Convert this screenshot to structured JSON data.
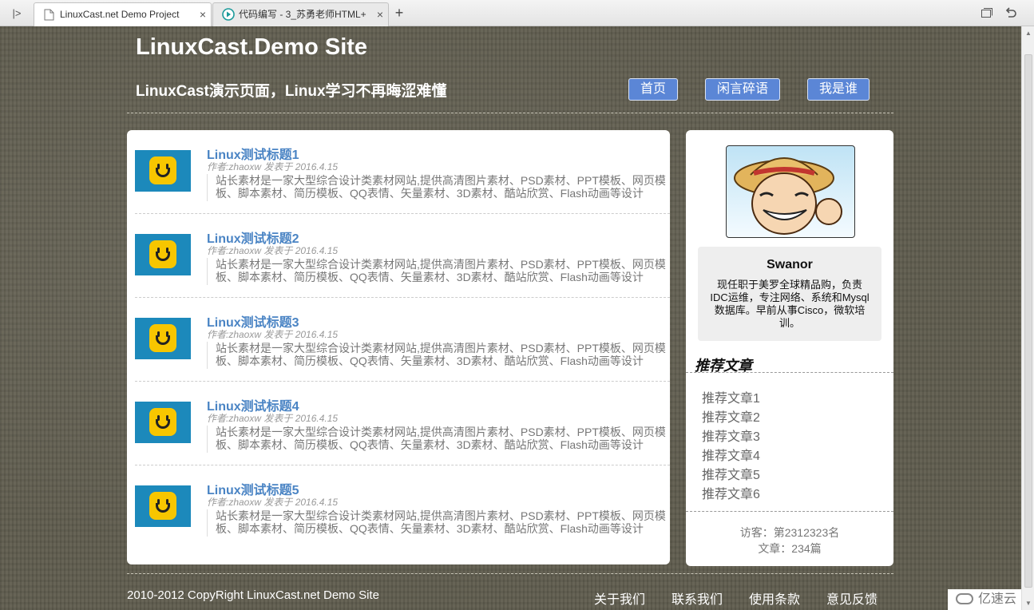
{
  "browser": {
    "tabs": [
      {
        "label": "LinuxCast.net Demo Project",
        "active": true
      },
      {
        "label": "代码编写 - 3_苏勇老师HTML+",
        "active": false
      }
    ],
    "sidebar_toggle": "|>",
    "new_tab": "+",
    "close": "×"
  },
  "site": {
    "title": "LinuxCast.Demo Site",
    "subtitle": "LinuxCast演示页面，Linux学习不再晦涩难懂",
    "nav": [
      "首页",
      "闲言碎语",
      "我是谁"
    ]
  },
  "articles": [
    {
      "title": "Linux测试标题1",
      "meta": "作者:zhaoxw 发表于 2016.4.15",
      "desc": "站长素材是一家大型综合设计类素材网站,提供高清图片素材、PSD素材、PPT模板、网页模板、脚本素材、简历模板、QQ表情、矢量素材、3D素材、酷站欣赏、Flash动画等设计"
    },
    {
      "title": "Linux测试标题2",
      "meta": "作者:zhaoxw 发表于 2016.4.15",
      "desc": "站长素材是一家大型综合设计类素材网站,提供高清图片素材、PSD素材、PPT模板、网页模板、脚本素材、简历模板、QQ表情、矢量素材、3D素材、酷站欣赏、Flash动画等设计"
    },
    {
      "title": "Linux测试标题3",
      "meta": "作者:zhaoxw 发表于 2016.4.15",
      "desc": "站长素材是一家大型综合设计类素材网站,提供高清图片素材、PSD素材、PPT模板、网页模板、脚本素材、简历模板、QQ表情、矢量素材、3D素材、酷站欣赏、Flash动画等设计"
    },
    {
      "title": "Linux测试标题4",
      "meta": "作者:zhaoxw 发表于 2016.4.15",
      "desc": "站长素材是一家大型综合设计类素材网站,提供高清图片素材、PSD素材、PPT模板、网页模板、脚本素材、简历模板、QQ表情、矢量素材、3D素材、酷站欣赏、Flash动画等设计"
    },
    {
      "title": "Linux测试标题5",
      "meta": "作者:zhaoxw 发表于 2016.4.15",
      "desc": "站长素材是一家大型综合设计类素材网站,提供高清图片素材、PSD素材、PPT模板、网页模板、脚本素材、简历模板、QQ表情、矢量素材、3D素材、酷站欣赏、Flash动画等设计"
    }
  ],
  "sidebar": {
    "name": "Swanor",
    "bio": "现任职于美罗全球精品购，负责IDC运维，专注网络、系统和Mysql数据库。早前从事Cisco，微软培训。",
    "recommend_title": "推荐文章",
    "recommend": [
      "推荐文章1",
      "推荐文章2",
      "推荐文章3",
      "推荐文章4",
      "推荐文章5",
      "推荐文章6"
    ],
    "visitors": "访客：第2312323名",
    "posts": "文章：234篇"
  },
  "footer": {
    "copyright": "2010-2012 CopyRight LinuxCast.net Demo Site",
    "links": [
      "关于我们",
      "联系我们",
      "使用条款",
      "意见反馈"
    ]
  },
  "watermark": "亿速云",
  "colors": {
    "background": "#5f5c4e",
    "nav_button": "#5b86d6",
    "article_title": "#4a84c4",
    "thumb_bg": "#1c89bb",
    "thumb_face": "#f7c600"
  }
}
